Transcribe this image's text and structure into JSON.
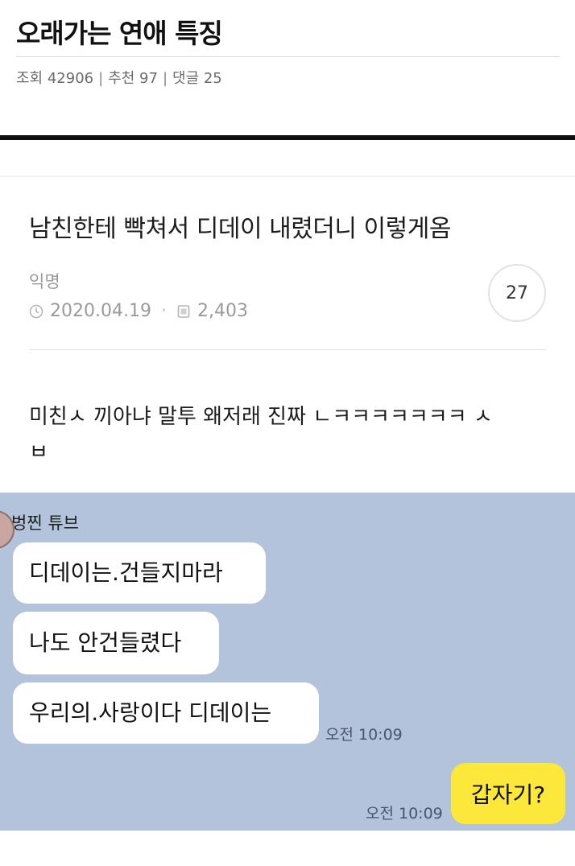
{
  "article": {
    "title": "오래가는 연애 특징",
    "views": "조회 42906",
    "recommends": "추천 97",
    "comments": "댓글 25",
    "separator": "|"
  },
  "screenshot": {
    "post_title": "남친한테 빡쳐서 디데이 내렸더니 이렇게옴",
    "author": "익명",
    "date": "2020.04.19",
    "view_count": "2,403",
    "comment_count": "27",
    "body_line1": "미친ㅅ 끼아냐 말투 왜저래 진짜 ㄴㅋㅋㅋㅋㅋㅋㅋ ㅅ",
    "body_line2": "ㅂ",
    "icons": [
      "clock-icon",
      "document-icon"
    ]
  },
  "chat": {
    "background": "#b3c3dc",
    "sender": "벙찐 튜브",
    "messages": [
      "디데이는.건들지마라",
      "나도 안건들렸다",
      "우리의.사랑이다 디데이는"
    ],
    "time_received": "오전 10:09",
    "my_message": "갑자기?",
    "my_bubble_color": "#fce83a",
    "time_sent": "오전 10:09"
  }
}
